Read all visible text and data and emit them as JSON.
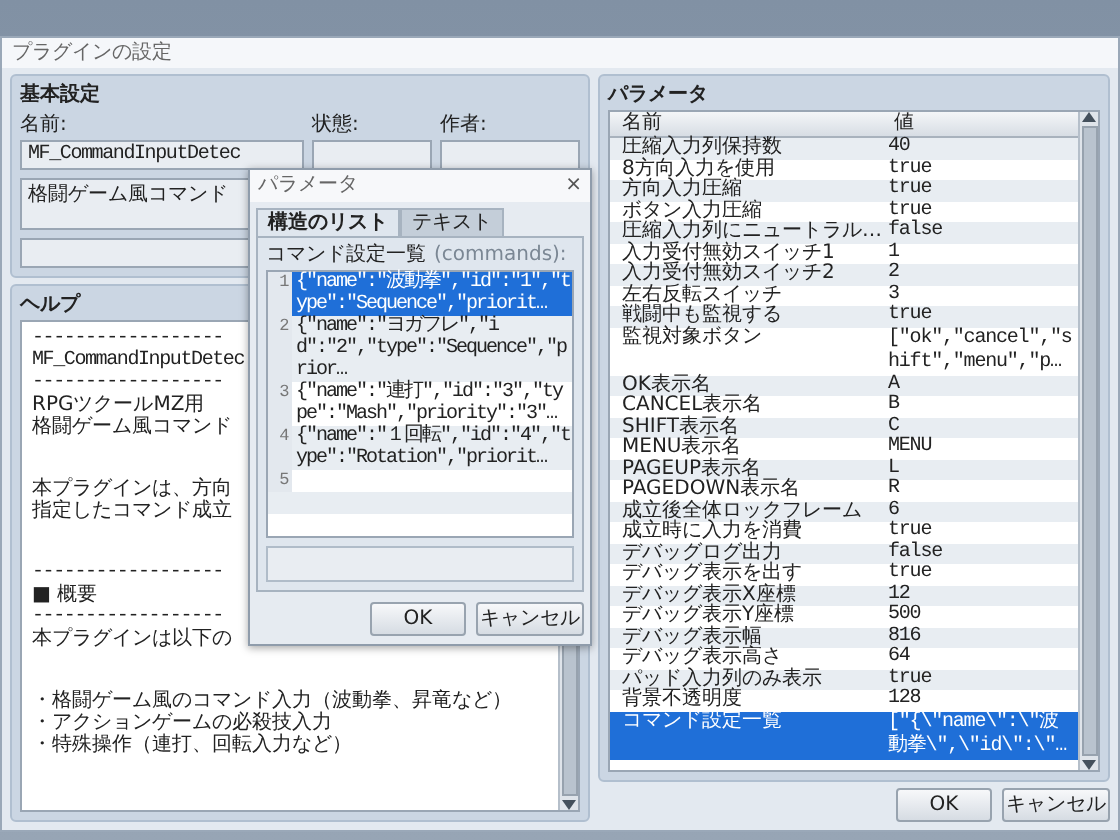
{
  "window": {
    "title": "プラグインの設定"
  },
  "basic_settings": {
    "title": "基本設定",
    "name_label": "名前:",
    "name_value": "MF_CommandInputDetec",
    "status_label": "状態:",
    "author_label": "作者:",
    "description": "格闘ゲーム風コマンド"
  },
  "help": {
    "title": "ヘルプ",
    "paragraphs": [
      {
        "lines": [
          {
            "text": "------------------",
            "kind": "mono"
          },
          {
            "text": "MF_CommandInputDetec",
            "kind": "mono"
          },
          {
            "text": "------------------",
            "kind": "mono"
          },
          {
            "text": "RPGツクールMZ用",
            "kind": "text"
          },
          {
            "text": "格闘ゲーム風コマンド",
            "kind": "text"
          }
        ]
      },
      {
        "lines": [
          {
            "text": "本プラグインは、方向",
            "kind": "text"
          },
          {
            "text": "指定したコマンド成立",
            "kind": "text"
          }
        ]
      },
      {
        "lines": [
          {
            "text": "------------------",
            "kind": "mono"
          },
          {
            "text": "■ 概要",
            "kind": "text"
          },
          {
            "text": "------------------",
            "kind": "mono"
          },
          {
            "text": "本プラグインは以下の",
            "kind": "text"
          }
        ]
      },
      {
        "lines": [
          {
            "text": "・格闘ゲーム風のコマンド入力（波動拳、昇竜など）",
            "kind": "text"
          },
          {
            "text": "・アクションゲームの必殺技入力",
            "kind": "text"
          },
          {
            "text": "・特殊操作（連打、回転入力など）",
            "kind": "text"
          }
        ]
      }
    ]
  },
  "parameters": {
    "title": "パラメータ",
    "columns": [
      "名前",
      "値"
    ],
    "rows": [
      {
        "name": "圧縮入力列保持数",
        "value": "40",
        "selected": false
      },
      {
        "name": "8方向入力を使用",
        "value": "true",
        "selected": false
      },
      {
        "name": "方向入力圧縮",
        "value": "true",
        "selected": false
      },
      {
        "name": "ボタン入力圧縮",
        "value": "true",
        "selected": false
      },
      {
        "name": "圧縮入力列にニュートラル…",
        "value": "false",
        "selected": false
      },
      {
        "name": "入力受付無効スイッチ1",
        "value": "1",
        "selected": false
      },
      {
        "name": "入力受付無効スイッチ2",
        "value": "2",
        "selected": false
      },
      {
        "name": "左右反転スイッチ",
        "value": "3",
        "selected": false
      },
      {
        "name": "戦闘中も監視する",
        "value": "true",
        "selected": false
      },
      {
        "name": "監視対象ボタン",
        "value": "[\"ok\",\"cancel\",\"shift\",\"menu\",\"p…",
        "selected": false
      },
      {
        "name": "OK表示名",
        "value": "A",
        "selected": false
      },
      {
        "name": "CANCEL表示名",
        "value": "B",
        "selected": false
      },
      {
        "name": "SHIFT表示名",
        "value": "C",
        "selected": false
      },
      {
        "name": "MENU表示名",
        "value": "MENU",
        "selected": false
      },
      {
        "name": "PAGEUP表示名",
        "value": "L",
        "selected": false
      },
      {
        "name": "PAGEDOWN表示名",
        "value": "R",
        "selected": false
      },
      {
        "name": "成立後全体ロックフレーム",
        "value": "6",
        "selected": false
      },
      {
        "name": "成立時に入力を消費",
        "value": "true",
        "selected": false
      },
      {
        "name": "デバッグログ出力",
        "value": "false",
        "selected": false
      },
      {
        "name": "デバッグ表示を出す",
        "value": "true",
        "selected": false
      },
      {
        "name": "デバッグ表示X座標",
        "value": "12",
        "selected": false
      },
      {
        "name": "デバッグ表示Y座標",
        "value": "500",
        "selected": false
      },
      {
        "name": "デバッグ表示幅",
        "value": "816",
        "selected": false
      },
      {
        "name": "デバッグ表示高さ",
        "value": "64",
        "selected": false
      },
      {
        "name": "パッド入力列のみ表示",
        "value": "true",
        "selected": false
      },
      {
        "name": "背景不透明度",
        "value": "128",
        "selected": false
      },
      {
        "name": "コマンド設定一覧",
        "value": "[\"{\\\"name\\\":\\\"波動拳\\\",\\\"id\\\":\\\"…",
        "selected": true
      }
    ],
    "buttons": [
      "OK",
      "キャンセル"
    ]
  },
  "dialog": {
    "title": "パラメータ",
    "close": "×",
    "tabs": [
      {
        "label": "構造のリスト",
        "selected": true
      },
      {
        "label": "テキスト",
        "selected": false
      }
    ],
    "list_label": "コマンド設定一覧",
    "list_key": "(commands):",
    "rows": [
      {
        "number": "1",
        "text": "{\"name\":\"波動拳\",\"id\":\"1\",\"type\":\"Sequence\",\"priorit…",
        "selected": true
      },
      {
        "number": "2",
        "text": "{\"name\":\"ヨガフレ\",\"id\":\"2\",\"type\":\"Sequence\",\"prior…",
        "selected": false
      },
      {
        "number": "3",
        "text": "{\"name\":\"連打\",\"id\":\"3\",\"type\":\"Mash\",\"priority\":\"3\"…",
        "selected": false
      },
      {
        "number": "4",
        "text": "{\"name\":\"１回転\",\"id\":\"4\",\"type\":\"Rotation\",\"priorit…",
        "selected": false
      },
      {
        "number": "5",
        "selected": false
      }
    ],
    "buttons": [
      "OK",
      "キャンセル"
    ]
  }
}
